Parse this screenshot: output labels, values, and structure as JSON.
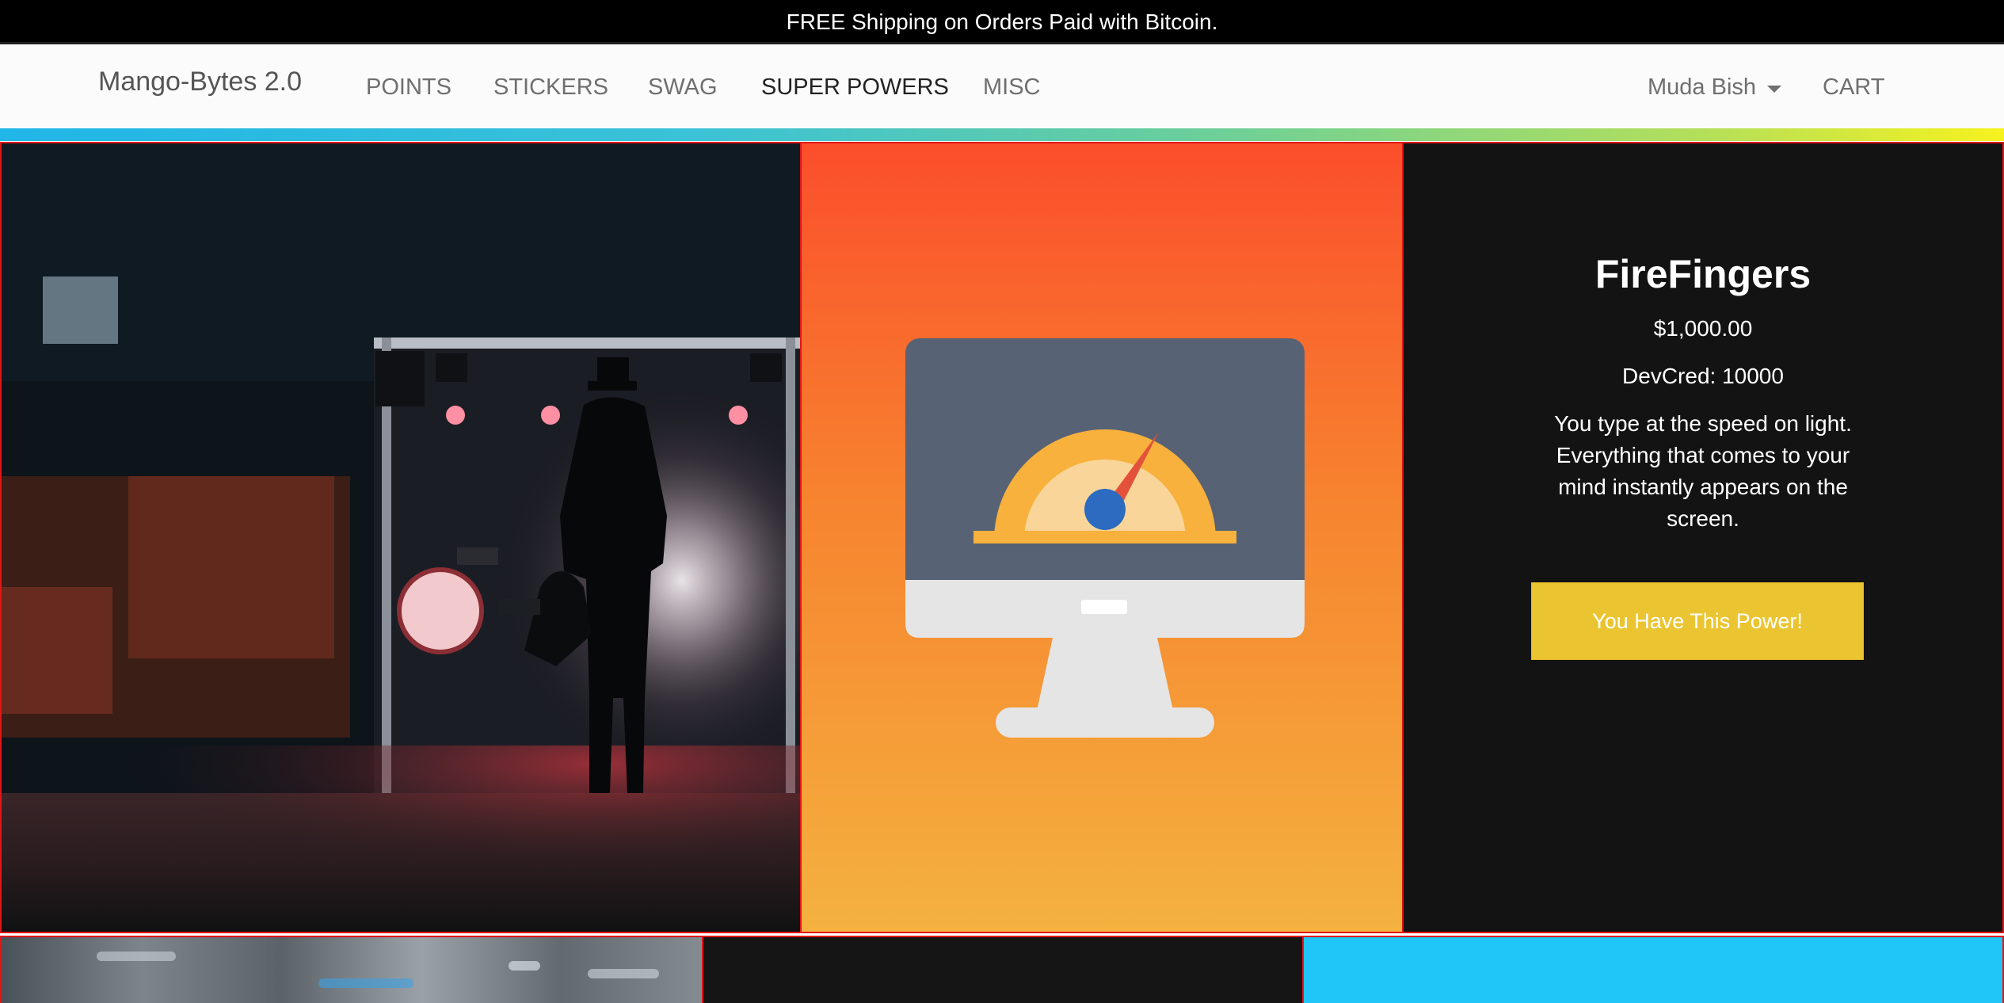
{
  "announcement": "FREE Shipping on Orders Paid with Bitcoin.",
  "navbar": {
    "brand": "Mango-Bytes 2.0",
    "items": [
      "POINTS",
      "STICKERS",
      "SWAG",
      "SUPER POWERS",
      "MISC"
    ],
    "active_item": "SUPER POWERS",
    "user": "Muda Bish",
    "cart": "CART"
  },
  "product": {
    "title": "FireFingers",
    "price": "$1,000.00",
    "devcred": "DevCred: 10000",
    "description": "You type at the speed on light. Everything that comes to your mind instantly appears on the screen.",
    "button": "You Have This Power!"
  },
  "colors": {
    "accent_button": "#ebc531",
    "tile_border": "#e01616",
    "icon_gradient_top": "#fb4e2b",
    "icon_gradient_bottom": "#f4b23f",
    "info_background": "#131313",
    "blue_tile": "#20c6f7"
  },
  "icons": {
    "product_icon": "speedometer-monitor-icon",
    "dropdown": "caret-down-icon"
  }
}
